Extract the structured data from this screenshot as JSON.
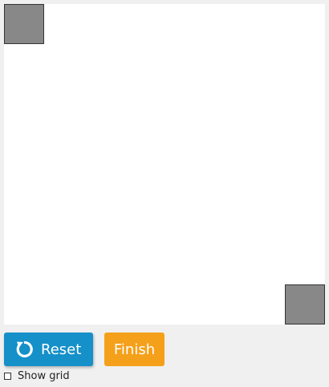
{
  "toolbar": {
    "reset_label": "Reset",
    "finish_label": "Finish",
    "reset_icon": "refresh-icon"
  },
  "options": {
    "show_grid_label": "Show grid",
    "show_grid_checked": false
  },
  "colors": {
    "reset_button": "#1590c9",
    "finish_button": "#f5a01a",
    "shape_fill": "#888888",
    "canvas_bg": "#ffffff",
    "page_bg": "#f0f0f0"
  }
}
